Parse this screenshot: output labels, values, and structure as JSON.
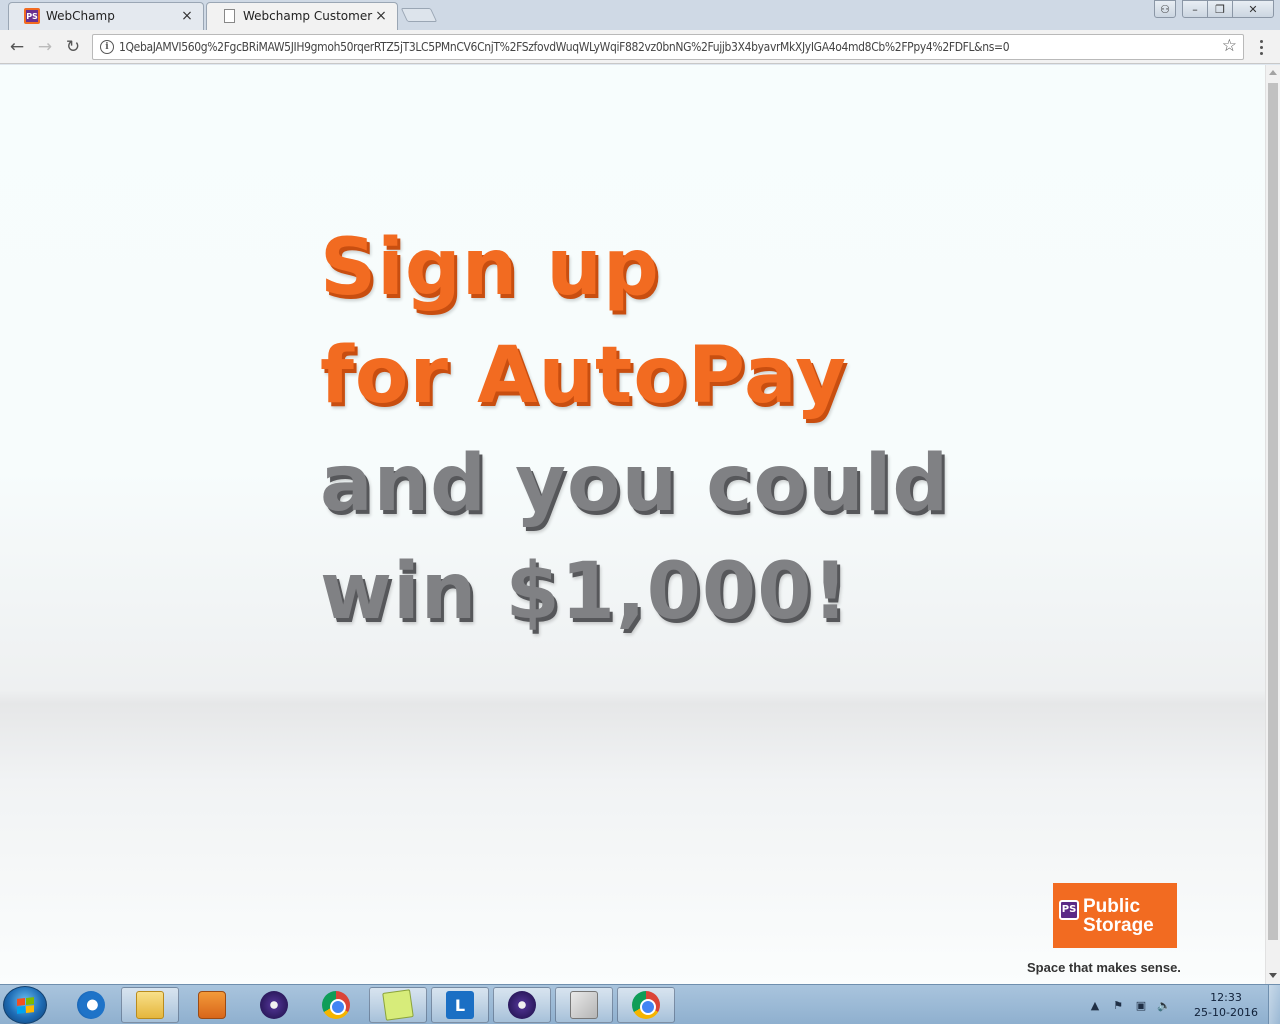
{
  "browser": {
    "tabs": [
      {
        "title": "WebChamp",
        "close": "×",
        "icon": "public-storage-icon"
      },
      {
        "title": "Webchamp Customer Fa",
        "close": "×",
        "icon": "page-icon"
      }
    ],
    "window_controls": {
      "profile": "⚇",
      "minimize": "–",
      "maximize": "❐",
      "close": "✕"
    },
    "toolbar": {
      "back": "←",
      "forward": "→",
      "reload": "↻",
      "star": "☆",
      "info": "i"
    },
    "url": "1QebaJAMVI560g%2FgcBRiMAW5JIH9gmoh50rqerRTZ5jT3LC5PMnCV6CnjT%2FSzfovdWuqWLyWqiF882vz0bnNG%2Fujjb3X4byavrMkXJyIGA4o4md8Cb%2FPpy4%2FDFL&ns=0"
  },
  "page": {
    "headline": {
      "line1": "Sign up",
      "line2": "for AutoPay",
      "line3": "and you could",
      "line4": "win $1,000!"
    },
    "logo": {
      "mark": "PS",
      "text_line1": "Public",
      "text_line2": "Storage"
    },
    "tagline": "Space that makes sense.",
    "colors": {
      "orange": "#f26b21",
      "gray": "#808184"
    }
  },
  "taskbar": {
    "apps": [
      {
        "name": "internet-explorer-icon"
      },
      {
        "name": "windows-explorer-icon"
      },
      {
        "name": "media-player-icon"
      },
      {
        "name": "eclipse-icon"
      },
      {
        "name": "chrome-icon"
      },
      {
        "name": "sticky-notes-icon"
      },
      {
        "name": "lync-icon",
        "glyph": "L"
      },
      {
        "name": "eclipse-icon"
      },
      {
        "name": "tools-icon"
      },
      {
        "name": "chrome-icon"
      }
    ],
    "tray": {
      "up": "▲",
      "flag": "⚑",
      "network": "▣",
      "volume": "🔈"
    },
    "clock": {
      "time": "12:33",
      "date": "25-10-2016"
    }
  }
}
